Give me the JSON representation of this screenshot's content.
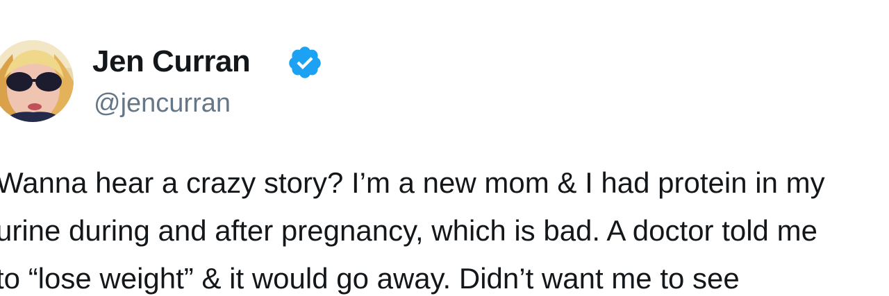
{
  "user": {
    "display_name": "Jen Curran",
    "handle": "@jencurran",
    "verified_icon": "verified-badge-icon",
    "avatar_icon": "profile-photo",
    "verified_color": "#1da1f2"
  },
  "tweet": {
    "lines": [
      "Wanna hear a crazy story? I’m a new mom & I had protein in my",
      "urine during and after pregnancy, which is bad. A doctor told me",
      "to “lose weight” & it would go away. Didn’t want me to see"
    ]
  }
}
